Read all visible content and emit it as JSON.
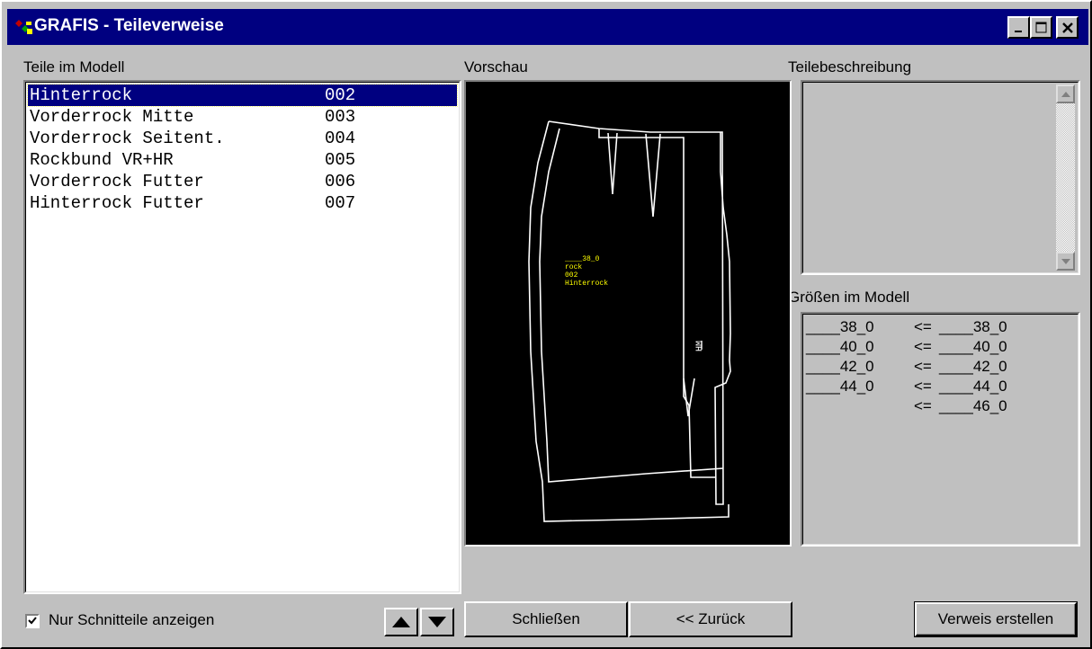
{
  "window": {
    "title": "GRAFIS - Teileverweise",
    "minimize_glyph": "_",
    "maximize_glyph": "□",
    "close_glyph": "✕"
  },
  "labels": {
    "parts": "Teile im Modell",
    "preview": "Vorschau",
    "description": "Teilebeschreibung",
    "sizes": "Größen im Modell"
  },
  "parts_list": [
    {
      "name": "Hinterrock",
      "number": "002",
      "selected": true
    },
    {
      "name": "Vorderrock Mitte",
      "number": "003",
      "selected": false
    },
    {
      "name": "Vorderrock Seitent.",
      "number": "004",
      "selected": false
    },
    {
      "name": "Rockbund VR+HR",
      "number": "005",
      "selected": false
    },
    {
      "name": "Vorderrock Futter",
      "number": "006",
      "selected": false
    },
    {
      "name": "Hinterrock Futter",
      "number": "007",
      "selected": false
    }
  ],
  "preview": {
    "label_lines": [
      "____38_0",
      "rock",
      "002",
      "Hinterrock"
    ],
    "marker": "HM",
    "line_color": "#ffffff",
    "text_color": "#ffff00"
  },
  "description_text": "",
  "sizes": [
    {
      "left": "____38_0",
      "arrow": "<=",
      "right": "____38_0"
    },
    {
      "left": "____40_0",
      "arrow": "<=",
      "right": "____40_0"
    },
    {
      "left": "____42_0",
      "arrow": "<=",
      "right": "____42_0"
    },
    {
      "left": "____44_0",
      "arrow": "<=",
      "right": "____44_0"
    },
    {
      "left": "",
      "arrow": "<=",
      "right": "____46_0"
    }
  ],
  "footer": {
    "checkbox_label": "Nur Schnitteile anzeigen",
    "checkbox_checked": true,
    "close_button": "Schließen",
    "back_button": "<< Zurück",
    "create_button": "Verweis erstellen"
  },
  "colors": {
    "titlebar": "#000080",
    "face": "#c0c0c0",
    "selection": "#000080"
  }
}
